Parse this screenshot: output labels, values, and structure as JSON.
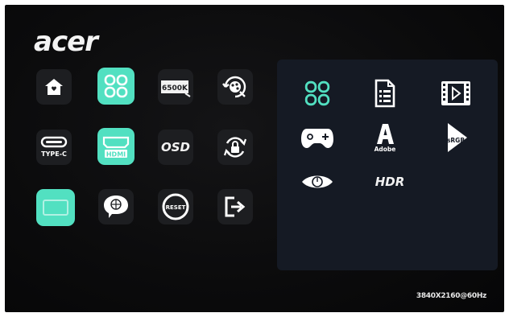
{
  "brand": {
    "logo_text": "acer"
  },
  "menu": {
    "items": [
      {
        "id": "home",
        "icon": "home-icon",
        "active": false
      },
      {
        "id": "modes",
        "icon": "modes-grid-icon",
        "active": true
      },
      {
        "id": "color-temp",
        "icon": "color-temperature-icon",
        "label": "6500K",
        "active": false
      },
      {
        "id": "color-settings",
        "icon": "color-palette-icon",
        "active": false
      },
      {
        "id": "input",
        "icon": "type-c-port-icon",
        "label": "TYPE-C",
        "active": false
      },
      {
        "id": "hdmi",
        "icon": "hdmi-port-icon",
        "label": "HDMI",
        "active": true
      },
      {
        "id": "osd",
        "icon": "osd-icon",
        "label": "OSD",
        "active": false
      },
      {
        "id": "lock",
        "icon": "rotate-lock-icon",
        "active": false
      },
      {
        "id": "display",
        "icon": "display-icon",
        "active": true
      },
      {
        "id": "language",
        "icon": "language-bubble-icon",
        "active": false
      },
      {
        "id": "reset",
        "icon": "reset-icon",
        "label": "RESET",
        "active": false
      },
      {
        "id": "exit",
        "icon": "exit-icon",
        "active": false
      }
    ]
  },
  "submenu": {
    "items": [
      {
        "id": "standard",
        "icon": "modes-grid-icon",
        "active": true
      },
      {
        "id": "document",
        "icon": "document-icon"
      },
      {
        "id": "movie",
        "icon": "movie-icon"
      },
      {
        "id": "game",
        "icon": "gamepad-icon"
      },
      {
        "id": "adobe",
        "icon": "adobe-icon",
        "label": "Adobe"
      },
      {
        "id": "srgb",
        "icon": "srgb-icon",
        "label": "sRGB"
      },
      {
        "id": "eco",
        "icon": "eye-icon"
      },
      {
        "id": "hdr",
        "icon": "hdr-icon",
        "label": "HDR"
      }
    ]
  },
  "status": {
    "resolution": "3840X2160@60Hz"
  },
  "colors": {
    "accent": "#52e0c1",
    "tile": "#1d1e21",
    "panel": "#151a24",
    "background": "#0b0b0c"
  }
}
